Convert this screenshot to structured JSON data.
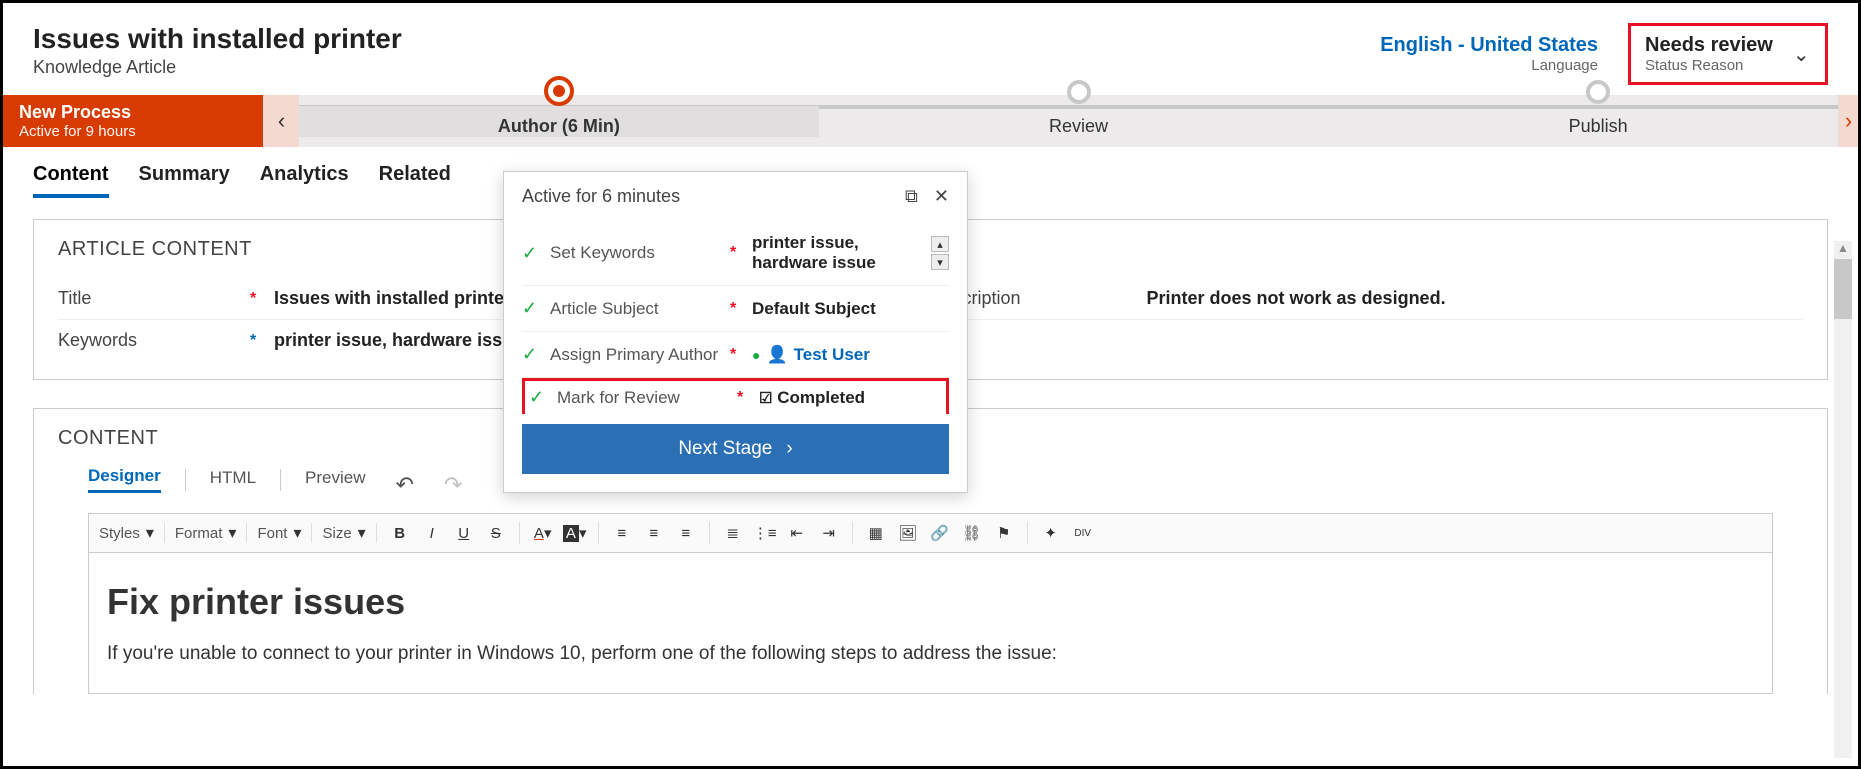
{
  "header": {
    "title": "Issues with installed printer",
    "subtitle": "Knowledge Article",
    "language": "English - United States",
    "language_label": "Language",
    "status": "Needs review",
    "status_label": "Status Reason"
  },
  "process": {
    "name": "New Process",
    "active_for": "Active for 9 hours",
    "stages": [
      {
        "label": "Author  (6 Min)",
        "active": true
      },
      {
        "label": "Review",
        "active": false
      },
      {
        "label": "Publish",
        "active": false
      }
    ]
  },
  "tabs": [
    "Content",
    "Summary",
    "Analytics",
    "Related"
  ],
  "active_tab": 0,
  "article_content": {
    "section_title": "ARTICLE CONTENT",
    "fields": {
      "title_label": "Title",
      "title_value": "Issues with installed printer",
      "description_label": "Description",
      "description_value": "Printer does not work as designed.",
      "keywords_label": "Keywords",
      "keywords_value": "printer issue, hardware issue"
    }
  },
  "content_section_title": "CONTENT",
  "editor_tabs": [
    "Designer",
    "HTML",
    "Preview"
  ],
  "active_editor_tab": 0,
  "toolbar": {
    "styles": "Styles",
    "format": "Format",
    "font": "Font",
    "size": "Size"
  },
  "editor": {
    "heading": "Fix printer issues",
    "paragraph": "If you're unable to connect to your printer in Windows 10, perform one of the following steps to address the issue:"
  },
  "flyout": {
    "title": "Active for 6 minutes",
    "rows": [
      {
        "label": "Set Keywords",
        "required": true,
        "value": "printer issue, hardware issue"
      },
      {
        "label": "Article Subject",
        "required": true,
        "value": "Default Subject"
      },
      {
        "label": "Assign Primary Author",
        "required": true,
        "value": "Test User",
        "user": true
      },
      {
        "label": "Mark for Review",
        "required": true,
        "value": "Completed",
        "checkbox": true,
        "highlight": true
      }
    ],
    "next_button": "Next Stage"
  }
}
